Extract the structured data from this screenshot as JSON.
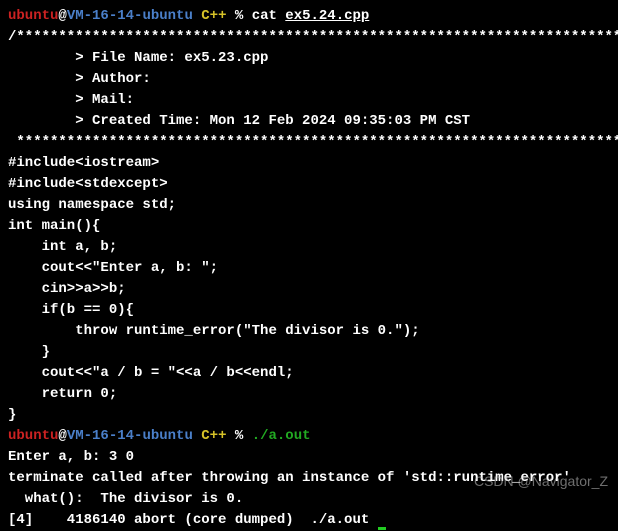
{
  "prompt1": {
    "user": "ubuntu",
    "at": "@",
    "host": "VM-16-14-ubuntu",
    "path": " C++ ",
    "sym": "% ",
    "cmd": "cat ",
    "arg": "ex5.24.cpp"
  },
  "code": {
    "star_open": "/*************************************************************************",
    "file_name": "        > File Name: ex5.23.cpp",
    "author": "        > Author: ",
    "mail": "        > Mail: ",
    "created": "        > Created Time: Mon 12 Feb 2024 09:35:03 PM CST",
    "star_close": " ************************************************************************/",
    "blank1": "",
    "inc1": "#include<iostream>",
    "inc2": "#include<stdexcept>",
    "ns": "using namespace std;",
    "blank2": "",
    "main": "int main(){",
    "decl": "    int a, b;",
    "cout1": "    cout<<\"Enter a, b: \";",
    "cin": "    cin>>a>>b;",
    "if": "    if(b == 0){",
    "throw": "        throw runtime_error(\"The divisor is 0.\");",
    "brace1": "    }",
    "cout2": "    cout<<\"a / b = \"<<a / b<<endl;",
    "ret": "    return 0;",
    "brace2": "}"
  },
  "prompt2": {
    "user": "ubuntu",
    "at": "@",
    "host": "VM-16-14-ubuntu",
    "path": " C++ ",
    "sym": "% ",
    "exec": "./a.out"
  },
  "output": {
    "enter": "Enter a, b: 3 0",
    "term": "terminate called after throwing an instance of 'std::runtime_error'",
    "what": "  what():  The divisor is 0.",
    "abort": "[4]    4186140 abort (core dumped)  ./a.out"
  },
  "watermark": "CSDN @Navigator_Z"
}
